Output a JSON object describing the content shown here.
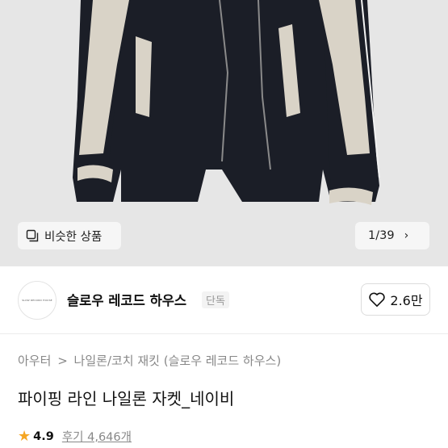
{
  "gallery": {
    "similar_label": "비슷한 상품",
    "pager": "1/39",
    "pager_icon": "chevron-right-icon",
    "image_colors": {
      "body": "#1b1e27",
      "panel": "#d9d3c7",
      "background": "#e6e6e6"
    }
  },
  "brand": {
    "logo_text": "SLOW RECORD HOUSE",
    "name": "슬로우 레코드 하우스",
    "badge": "단독",
    "likes": "2.6만",
    "like_icon": "heart-icon"
  },
  "breadcrumb": [
    "아우터",
    "나일론/코치 재킷 (슬로우 레코드 하우스)"
  ],
  "breadcrumb_sep": ">",
  "product": {
    "title": "파이핑 라인 나일론 자켓_네이비",
    "rating": "4.9",
    "reviews": "후기 4,646개",
    "rating_color": "#f5a623"
  }
}
